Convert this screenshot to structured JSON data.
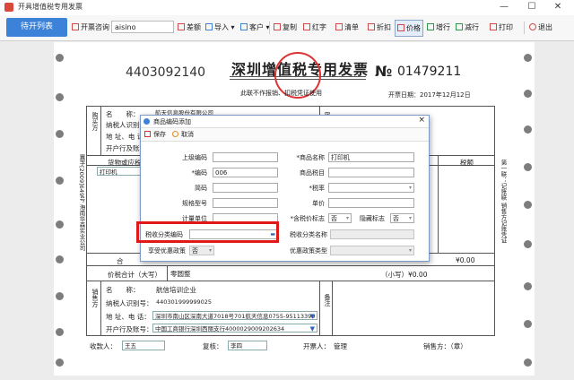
{
  "window": {
    "title": "开具增值税专用发票",
    "controls": [
      "—",
      "☐",
      "✕"
    ]
  },
  "toolbar": {
    "open_list": "待开列表",
    "query_label": "开票咨询",
    "query_value": "aisino",
    "items": [
      "差额",
      "导入",
      "客户",
      "复制",
      "红字",
      "清单",
      "折扣",
      "价格",
      "增行",
      "减行",
      "打印",
      "退出"
    ]
  },
  "invoice": {
    "code": "4403092140",
    "title": "深圳增值税专用发票",
    "no_symbol": "№",
    "number": "01479211",
    "subnote": "此联不作报销、扣税凭证使用",
    "issue_date": "开票日期：2017年12月12日",
    "buyer_side": "购买方",
    "buyer_labels": [
      "名　　称：",
      "纳税人识别号：",
      "地 址、电 话：",
      "开户行及账号："
    ],
    "buyer_name": "航天信息股份有限公司",
    "password_area": "密",
    "goods_header": "货物或应税",
    "goods_row": "打印机",
    "tax_header": "税额",
    "total_label": "合",
    "total_tax": "¥0.00",
    "price_total_label": "价税合计（大写）",
    "price_total_value": "零圆整",
    "small_write": "（小写）¥0.00",
    "seller_side": "销售方",
    "seller_labels": [
      "名　　称：",
      "纳税人识别号：",
      "地 址、电 话：",
      "开户行及账号："
    ],
    "seller_name": "航信培训企业",
    "seller_taxid": "440301999999025",
    "seller_addr": "深圳市南山区深南大道7018号701航天信息0755-95113399",
    "seller_bank": "中国工商银行深圳西丽支行4000029009202634",
    "remark_side": "备注",
    "payee_label": "收款人：",
    "payee_value": "王五",
    "reviewer_label": "复核：",
    "reviewer_value": "李四",
    "drawer_label": "开票人：",
    "drawer_value": "管理",
    "seller_sign": "销售方：（章）",
    "left_strip": "冀字[2009]649号 海南华森实业公司",
    "right_strip": "第一联：记账联 销售方记账凭证"
  },
  "dialog": {
    "title": "商品编码添加",
    "save": "保存",
    "cancel": "取消",
    "close": "×",
    "fields": {
      "parent_code": {
        "label": "上级编码",
        "value": ""
      },
      "code": {
        "label": "*编码",
        "value": "006"
      },
      "short_code": {
        "label": "简码",
        "value": ""
      },
      "spec": {
        "label": "规格型号",
        "value": ""
      },
      "unit": {
        "label": "计量单位",
        "value": ""
      },
      "tax_class_code": {
        "label": "税收分类编码",
        "value": ""
      },
      "preferential": {
        "label": "享受优惠政策",
        "value": "否"
      },
      "name": {
        "label": "*商品名称",
        "value": "打印机"
      },
      "tax_item": {
        "label": "商品税目",
        "value": ""
      },
      "tax_rate": {
        "label": "*税率",
        "value": ""
      },
      "unit_price": {
        "label": "单价",
        "value": ""
      },
      "price_incl_tax": {
        "label": "*含税价标志",
        "value": "否"
      },
      "hidden_flag": {
        "label": "隐藏标志",
        "value": "否"
      },
      "tax_class_name": {
        "label": "税收分类名称",
        "value": ""
      },
      "preferential_type": {
        "label": "优惠政策类型",
        "value": ""
      }
    }
  },
  "colors": {
    "accent": "#3c82d8",
    "highlight": "#e01818",
    "stamp": "#d33333"
  }
}
